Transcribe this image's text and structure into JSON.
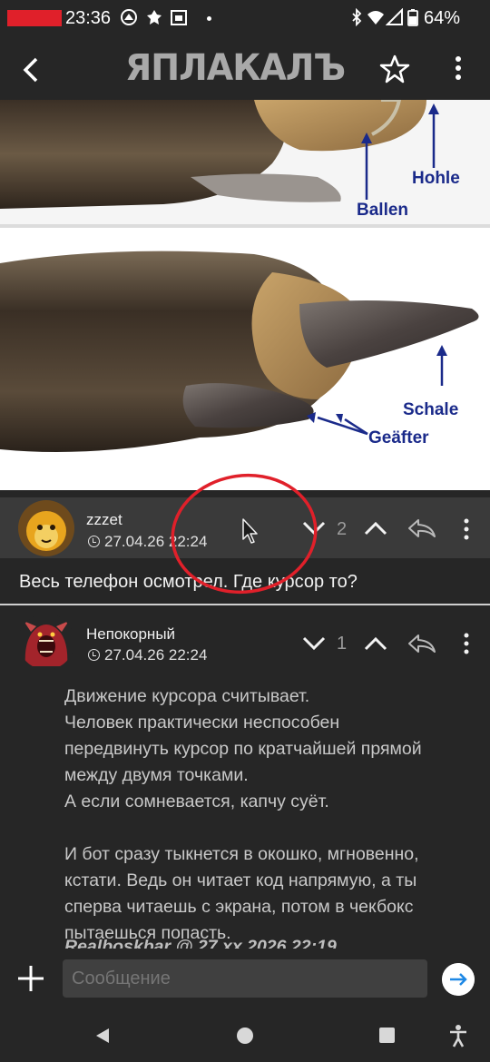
{
  "status_bar": {
    "time": "23:36",
    "battery_percent": "64%",
    "icons": [
      "settings-icon",
      "app-icon",
      "calendar-icon",
      "bluetooth-icon",
      "wifi-icon",
      "signal-icon",
      "battery-icon"
    ]
  },
  "app_bar": {
    "logo_text": "ЯПЛАКАЛЪ",
    "icons": [
      "back-icon",
      "star-icon",
      "more-vert-icon"
    ]
  },
  "photo": {
    "labels": [
      "Hohle",
      "Ballen",
      "Schale",
      "Geäfter"
    ]
  },
  "comments": [
    {
      "username": "zzzet",
      "date": "27.04.26 22:24",
      "score": "2",
      "text": "Весь телефон осмотрел. Где курсор то?"
    },
    {
      "username": "Непокорный",
      "date": "27.04.26 22:24",
      "score": "1",
      "paragraphs": [
        [
          "Движение курсора считывает.",
          "Человек практически неспособен",
          "передвинуть курсор по кратчайшей прямой",
          "между двумя точками.",
          "А если сомневается, капчу суёт."
        ],
        [
          "И бот сразу тыкнется в окошко, мгновенно,",
          "кстати. Ведь он читает код напрямую, а ты",
          "сперва читаешь с экрана, потом в чекбокс",
          "пытаешься попасть."
        ]
      ],
      "cut_quote": "Realboskbar @ 27.xx.2026 22:19"
    }
  ],
  "input_bar": {
    "placeholder": "Сообщение"
  },
  "colors": {
    "background": "#262626",
    "highlight_comment": "#3a3a3a",
    "annotation_red": "#e0202a",
    "label_blue": "#1a2a8a"
  }
}
